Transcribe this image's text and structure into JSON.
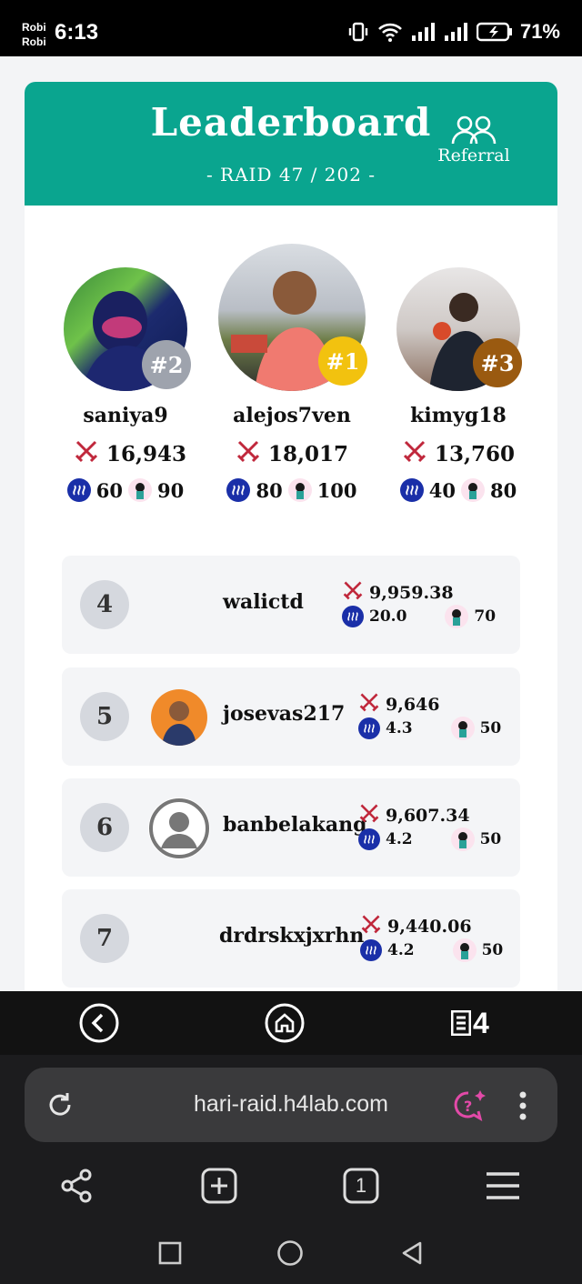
{
  "status_bar": {
    "carrier1": "Robi",
    "carrier2": "Robi",
    "time": "6:13",
    "battery": "71%"
  },
  "leaderboard": {
    "title": "Leaderboard",
    "subtitle": "- RAID 47 / 202 -",
    "referral_label": "Referral"
  },
  "podium": [
    {
      "rank_label": "#2",
      "name": "saniya9",
      "score": "16,943",
      "coin": "60",
      "char": "90",
      "badge_color": "#9ea3ad"
    },
    {
      "rank_label": "#1",
      "name": "alejos7ven",
      "score": "18,017",
      "coin": "80",
      "char": "100",
      "badge_color": "#f2c20f"
    },
    {
      "rank_label": "#3",
      "name": "kimyg18",
      "score": "13,760",
      "coin": "40",
      "char": "80",
      "badge_color": "#9a5a10"
    }
  ],
  "rows": [
    {
      "rank": "4",
      "name": "walictd",
      "score": "9,959.38",
      "coin": "20.0",
      "char": "70",
      "avatar": "none"
    },
    {
      "rank": "5",
      "name": "josevas217",
      "score": "9,646",
      "coin": "4.3",
      "char": "50",
      "avatar": "photo"
    },
    {
      "rank": "6",
      "name": "banbelakang",
      "score": "9,607.34",
      "coin": "4.2",
      "char": "50",
      "avatar": "placeholder-user-icon"
    },
    {
      "rank": "7",
      "name": "drdrskxjxrhn",
      "score": "9,440.06",
      "coin": "4.2",
      "char": "50",
      "avatar": "none"
    }
  ],
  "browser": {
    "url": "hari-raid.h4lab.com",
    "tab_count": "1",
    "logo_text": "4"
  },
  "colors": {
    "header": "#0aa58f",
    "coin": "#1a2fa8",
    "sword": "#c0283c"
  }
}
